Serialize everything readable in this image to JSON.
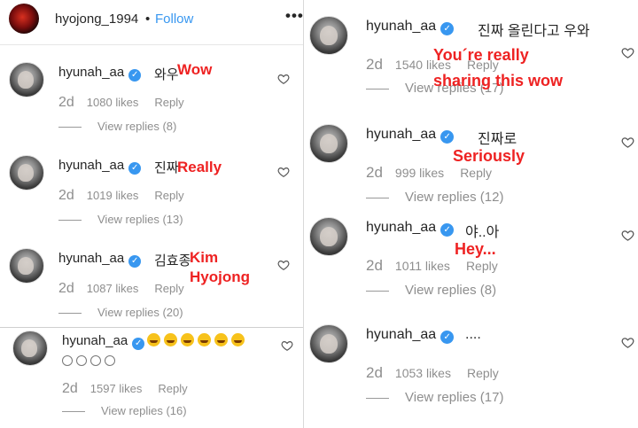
{
  "header": {
    "username": "hyojong_1994",
    "dot": "•",
    "follow_label": "Follow",
    "more": "•••"
  },
  "comments_left": [
    {
      "user": "hyunah_aa",
      "text": "와우",
      "age": "2d",
      "likes": "1080 likes",
      "reply": "Reply",
      "view_replies": "View replies (8)",
      "annotation": "Wow"
    },
    {
      "user": "hyunah_aa",
      "text": "진짜",
      "age": "2d",
      "likes": "1019 likes",
      "reply": "Reply",
      "view_replies": "View replies (13)",
      "annotation": "Really"
    },
    {
      "user": "hyunah_aa",
      "text": "김효종",
      "age": "2d",
      "likes": "1087 likes",
      "reply": "Reply",
      "view_replies": "View replies (20)",
      "annotation_line1": "Kim",
      "annotation_line2": "Hyojong"
    },
    {
      "user": "hyunah_aa",
      "emoji_count": 6,
      "smiley_count": 4,
      "age": "2d",
      "likes": "1597 likes",
      "reply": "Reply",
      "view_replies": "View replies (16)"
    }
  ],
  "comments_right": [
    {
      "user": "hyunah_aa",
      "text": "진짜 올린다고 우와",
      "age": "2d",
      "likes": "1540 likes",
      "reply": "Reply",
      "view_replies": "View replies (17)",
      "annotation_line1": "You´re  really",
      "annotation_line2": "sharing  this  wow"
    },
    {
      "user": "hyunah_aa",
      "text": "진짜로",
      "age": "2d",
      "likes": "999 likes",
      "reply": "Reply",
      "view_replies": "View replies (12)",
      "annotation": "Seriously"
    },
    {
      "user": "hyunah_aa",
      "text": "야..아",
      "age": "2d",
      "likes": "1011 likes",
      "reply": "Reply",
      "view_replies": "View replies (8)",
      "annotation": "Hey..."
    },
    {
      "user": "hyunah_aa",
      "text": "....",
      "age": "2d",
      "likes": "1053 likes",
      "reply": "Reply",
      "view_replies": "View replies (17)"
    }
  ],
  "icons": {
    "verified": "verified-badge-icon",
    "like": "heart-outline-icon"
  },
  "colors": {
    "follow": "#3897f0",
    "annotation": "#ee2222",
    "meta": "#8e8e8e",
    "text": "#262626"
  }
}
